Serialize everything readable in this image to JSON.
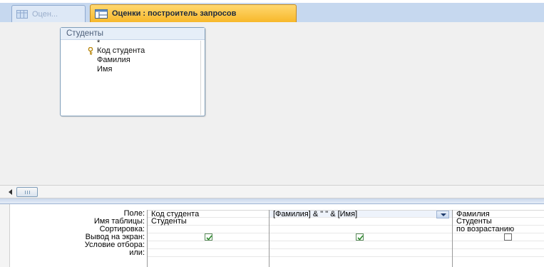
{
  "tabs": [
    {
      "label": "Оцен...",
      "icon": "table-icon",
      "state": "inactive"
    },
    {
      "label": "Оценки : построитель запросов",
      "icon": "query-design-icon",
      "state": "active"
    }
  ],
  "table": {
    "title": "Студенты",
    "fields": [
      "*",
      "Код студента",
      "Фамилия",
      "Имя"
    ],
    "primary_key": "Код студента"
  },
  "grid": {
    "row_labels": [
      "Поле:",
      "Имя таблицы:",
      "Сортировка:",
      "Вывод на экран:",
      "Условие отбора:",
      "или:"
    ],
    "columns": [
      {
        "field": "Код студента",
        "table": "Студенты",
        "sort": "",
        "show": true
      },
      {
        "field": "[Фамилия] & \" \" & [Имя]",
        "table": "",
        "sort": "",
        "show": true
      },
      {
        "field": "Фамилия",
        "table": "Студенты",
        "sort": "по возрастанию",
        "show": false
      }
    ]
  },
  "colors": {
    "accent": "#f7b82a",
    "tabbar": "#c6d8ef"
  }
}
